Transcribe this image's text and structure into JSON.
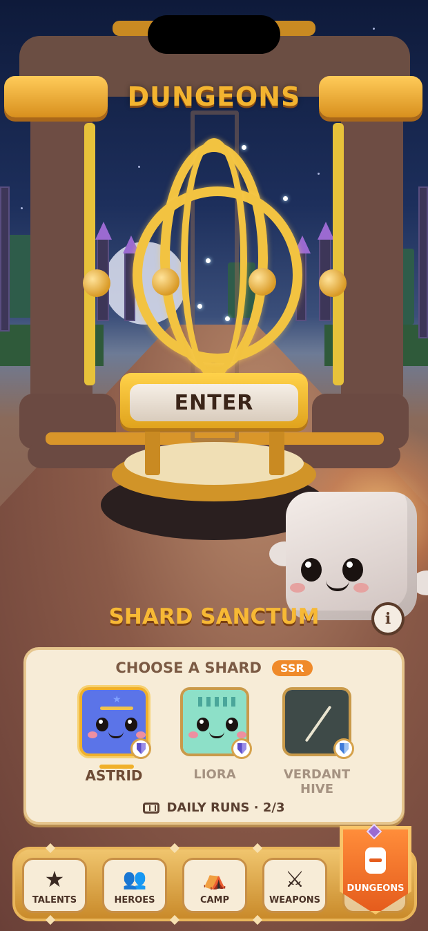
{
  "header": {
    "title": "DUNGEONS"
  },
  "portal": {
    "enter_label": "ENTER"
  },
  "location": {
    "name": "SHARD SANCTUM",
    "info_icon": "i"
  },
  "shard_panel": {
    "heading": "CHOOSE A SHARD",
    "rarity_badge": "SSR",
    "shards": [
      {
        "name": "ASTRID",
        "selected": true,
        "color": "#5b74e8"
      },
      {
        "name": "LIORA",
        "selected": false,
        "color": "#8de0c8"
      },
      {
        "name": "VERDANT HIVE",
        "selected": false,
        "color": "#3e4a48"
      }
    ],
    "daily_runs": "DAILY RUNS · 2/3"
  },
  "nav": {
    "items": [
      {
        "label": "TALENTS",
        "icon": "star-icon",
        "glyph": "★"
      },
      {
        "label": "HEROES",
        "icon": "people-icon",
        "glyph": "👥"
      },
      {
        "label": "CAMP",
        "icon": "tent-icon",
        "glyph": "⛺"
      },
      {
        "label": "WEAPONS",
        "icon": "crossed-swords-icon",
        "glyph": "⚔"
      }
    ],
    "active": {
      "label": "DUNGEONS",
      "icon": "backpack-icon"
    }
  },
  "colors": {
    "gold": "#f3b430",
    "accent_orange": "#e55c1d",
    "panel": "#f7ecd7"
  }
}
